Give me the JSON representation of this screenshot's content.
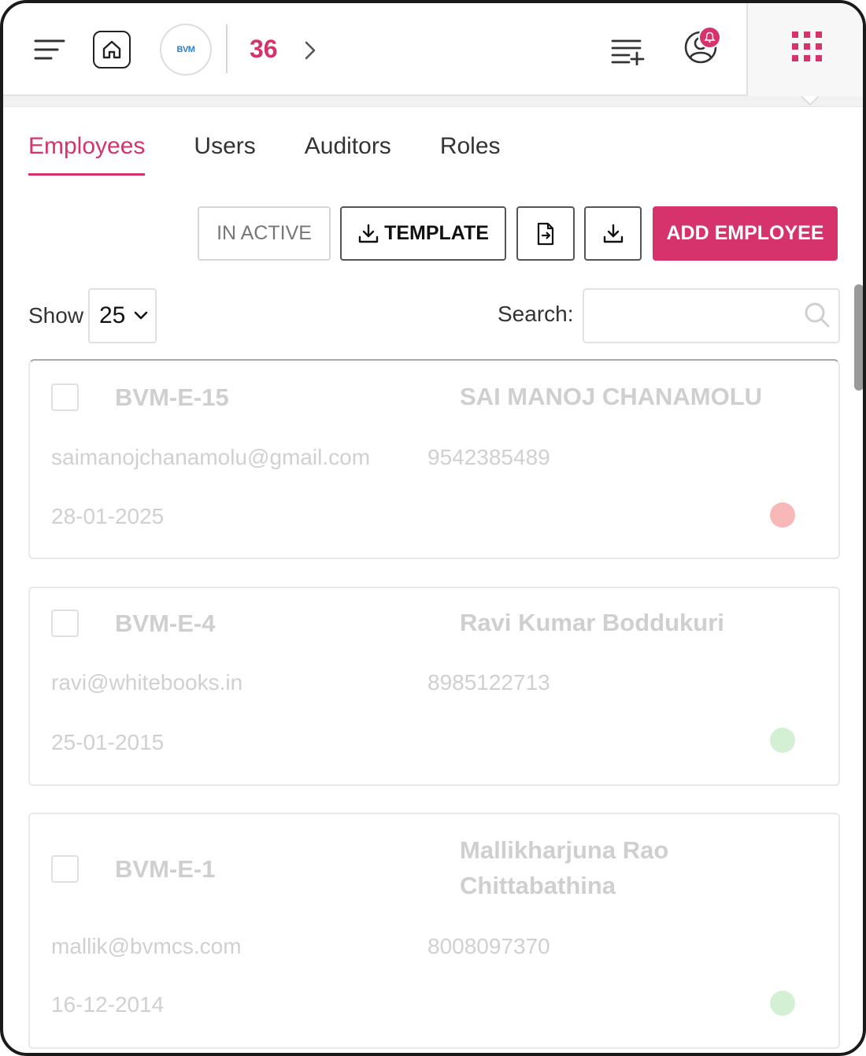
{
  "header": {
    "logo_text": "BVM",
    "count": "36",
    "colors": {
      "accent": "#d6336c"
    }
  },
  "tabs": [
    {
      "label": "Employees",
      "active": true
    },
    {
      "label": "Users",
      "active": false
    },
    {
      "label": "Auditors",
      "active": false
    },
    {
      "label": "Roles",
      "active": false
    }
  ],
  "actions": {
    "inactive_label": "IN ACTIVE",
    "template_label": "TEMPLATE",
    "add_label": "ADD EMPLOYEE"
  },
  "table_controls": {
    "show_label": "Show",
    "page_size": "25",
    "search_label": "Search:",
    "search_value": ""
  },
  "employees": [
    {
      "code": "BVM-E-15",
      "name": "SAI MANOJ CHANAMOLU",
      "email": "saimanojchanamolu@gmail.com",
      "phone": "9542385489",
      "date": "28-01-2025",
      "status": "inactive",
      "status_color": "#f8b8b8"
    },
    {
      "code": "BVM-E-4",
      "name": "Ravi Kumar Boddukuri",
      "email": "ravi@whitebooks.in",
      "phone": "8985122713",
      "date": "25-01-2015",
      "status": "active",
      "status_color": "#d4f0d4"
    },
    {
      "code": "BVM-E-1",
      "name": "Mallikharjuna Rao Chittabathina",
      "email": "mallik@bvmcs.com",
      "phone": "8008097370",
      "date": "16-12-2014",
      "status": "active",
      "status_color": "#d4f0d4"
    }
  ]
}
